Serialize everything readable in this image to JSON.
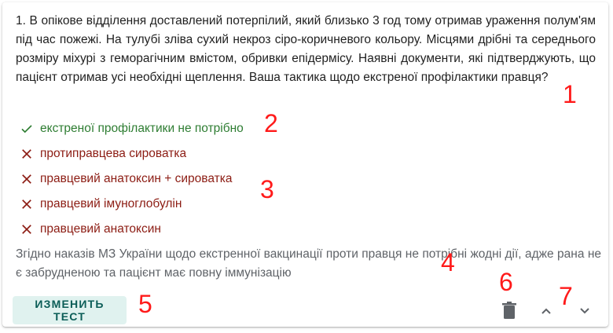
{
  "question": {
    "text": "1. В опікове відділення доставлений потерпілий, який близько 3 год тому отримав ураження полум'ям під час пожежі. На тулубі зліва сухий некроз сіро-коричневого кольору. Місцями дрібні та середнього розміру міхурі з геморагічним вмістом, обривки епідермісу. Наявні документи, які підтверджують, що пацієнт отримав усі необхідні щеплення. Ваша тактика щодо екстреної профілактики правця?"
  },
  "answers": [
    {
      "label": "екстреної профілактики не потрібно",
      "status": "correct",
      "icon": "check-icon"
    },
    {
      "label": "протиправцева сироватка",
      "status": "wrong",
      "icon": "close-icon"
    },
    {
      "label": "правцевий анатоксин + сироватка",
      "status": "wrong",
      "icon": "close-icon"
    },
    {
      "label": "правцевий імуноглобулін",
      "status": "wrong",
      "icon": "close-icon"
    },
    {
      "label": "правцевий анатоксин",
      "status": "wrong",
      "icon": "close-icon"
    }
  ],
  "explanation": "Згідно наказів МЗ України щодо екстренної вакцинації проти правця не потрібні жодні дії, адже рана не є забрудненою та пацієнт має повну іммунізацію",
  "actions": {
    "edit_label": "ИЗМЕНИТЬ ТЕСТ",
    "delete_icon": "trash-icon",
    "up_icon": "chevron-up-icon",
    "down_icon": "chevron-down-icon"
  },
  "markers": [
    "1",
    "2",
    "3",
    "4",
    "5",
    "6",
    "7"
  ],
  "colors": {
    "correct": "#2e7d32",
    "wrong": "#8c1c13",
    "button_bg": "#e0f2ef",
    "button_text": "#0b5d57",
    "marker": "#ff1a1a"
  }
}
